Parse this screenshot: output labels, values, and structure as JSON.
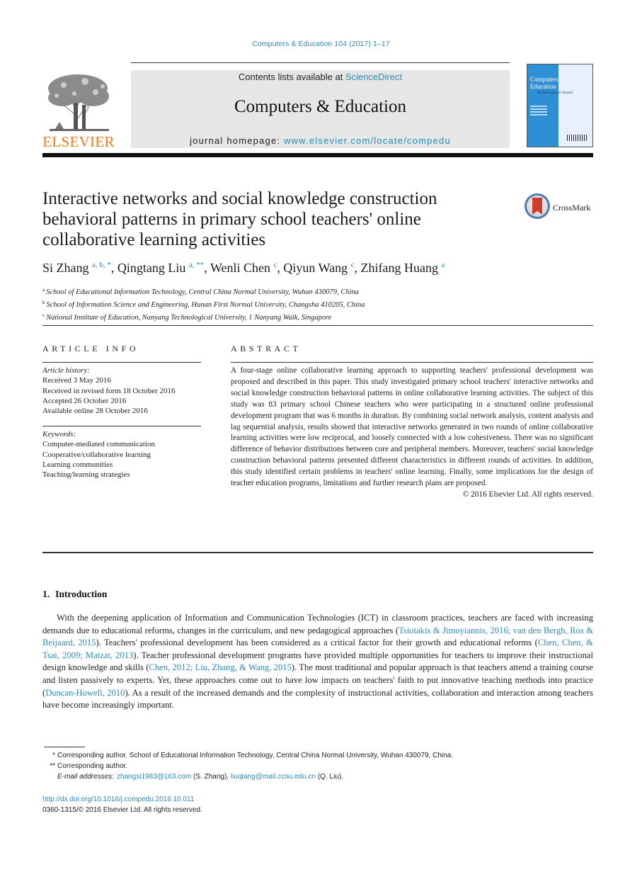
{
  "header": {
    "journal_reference": "Computers & Education 104 (2017) 1–17",
    "contents_prefix": "Contents lists available at ",
    "contents_link": "ScienceDirect",
    "journal_name": "Computers & Education",
    "homepage_prefix": "journal homepage: ",
    "homepage_link": "www.elsevier.com/locate/compedu",
    "publisher_logo_text": "ELSEVIER",
    "cover": {
      "title_line1": "Computers",
      "title_line2": "Education",
      "subtitle": "An International Journal"
    }
  },
  "article": {
    "title": "Interactive networks and social knowledge construction behavioral patterns in primary school teachers' online collaborative learning activities",
    "crossmark_label": "CrossMark",
    "authors": [
      {
        "name": "Si Zhang",
        "marks": "a, b, *"
      },
      {
        "name": "Qingtang Liu",
        "marks": "a, **"
      },
      {
        "name": "Wenli Chen",
        "marks": "c"
      },
      {
        "name": "Qiyun Wang",
        "marks": "c"
      },
      {
        "name": "Zhifang Huang",
        "marks": "a"
      }
    ],
    "affiliations": [
      {
        "mark": "a",
        "text": "School of Educational Information Technology, Central China Normal University, Wuhan 430079, China"
      },
      {
        "mark": "b",
        "text": "School of Information Science and Engineering, Hunan First Normal University, Changsha 410205, China"
      },
      {
        "mark": "c",
        "text": "National Institute of Education, Nanyang Technological University, 1 Nanyang Walk, Singapore"
      }
    ]
  },
  "article_info": {
    "heading": "ARTICLE INFO",
    "history_label": "Article history:",
    "history": [
      "Received 3 May 2016",
      "Received in revised form 18 October 2016",
      "Accepted 26 October 2016",
      "Available online 28 October 2016"
    ],
    "keywords_label": "Keywords:",
    "keywords": [
      "Computer-mediated communication",
      "Cooperative/collaborative learning",
      "Learning communities",
      "Teaching/learning strategies"
    ]
  },
  "abstract": {
    "heading": "ABSTRACT",
    "text": "A four-stage online collaborative learning approach to supporting teachers' professional development was proposed and described in this paper. This study investigated primary school teachers' interactive networks and social knowledge construction behavioral patterns in online collaborative learning activities. The subject of this study was 83 primary school Chinese teachers who were participating in a structured online professional development program that was 6 months in duration. By combining social network analysis, content analysis and lag sequential analysis, results showed that interactive networks generated in two rounds of online collaborative learning activities were low reciprocal, and loosely connected with a low cohesiveness. There was no significant difference of behavior distributions between core and peripheral members. Moreover, teachers' social knowledge construction behavioral patterns presented different characteristics in different rounds of activities. In addition, this study identified certain problems in teachers' online learning. Finally, some implications for the design of teacher education programs, limitations and further research plans are proposed.",
    "copyright": "© 2016 Elsevier Ltd. All rights reserved."
  },
  "introduction": {
    "number": "1.",
    "heading": "Introduction",
    "segments": [
      {
        "t": "With the deepening application of Information and Communication Technologies (ICT) in classroom practices, teachers are faced with increasing demands due to educational reforms, changes in the curriculum, and new pedagogical approaches (",
        "link": false
      },
      {
        "t": "Tsiotakis & Jimoyiannis, 2016; van den Bergh, Ros & Beijaard, 2015",
        "link": true
      },
      {
        "t": "). Teachers' professional development has been considered as a critical factor for their growth and educational reforms (",
        "link": false
      },
      {
        "t": "Chen, Chen, & Tsai, 2009; Matzat, 2013",
        "link": true
      },
      {
        "t": "). Teacher professional development programs have provided multiple opportunities for teachers to improve their instructional design knowledge and skills (",
        "link": false
      },
      {
        "t": "Chen, 2012; Liu, Zhang, & Wang, 2015",
        "link": true
      },
      {
        "t": "). The most traditional and popular approach is that teachers attend a training course and listen passively to experts. Yet, these approaches come out to have low impacts on teachers' faith to put innovative teaching methods into practice (",
        "link": false
      },
      {
        "t": "Duncan-Howell, 2010",
        "link": true
      },
      {
        "t": "). As a result of the increased demands and the complexity of instructional activities, collaboration and interaction among teachers have become increasingly important.",
        "link": false
      }
    ]
  },
  "footnotes": {
    "star1_mark": "*",
    "star1_text": "Corresponding author. School of Educational Information Technology, Central China Normal University, Wuhan 430079, China.",
    "star2_mark": "**",
    "star2_text": "Corresponding author.",
    "email_label": "E-mail addresses:",
    "email1": "zhangsi1983@163.com",
    "email1_owner": " (S. Zhang), ",
    "email2": "liuqtang@mail.ccnu.edu.cn",
    "email2_owner": " (Q. Liu)."
  },
  "doi": {
    "link": "http://dx.doi.org/10.1016/j.compedu.2016.10.011",
    "issn_line": "0360-1315/© 2016 Elsevier Ltd. All rights reserved."
  },
  "colors": {
    "link": "#2a8bb8",
    "elsevier_orange": "#f07a1e",
    "banner_gray": "#e6e6e6",
    "cover_blue": "#2e8fd6"
  }
}
